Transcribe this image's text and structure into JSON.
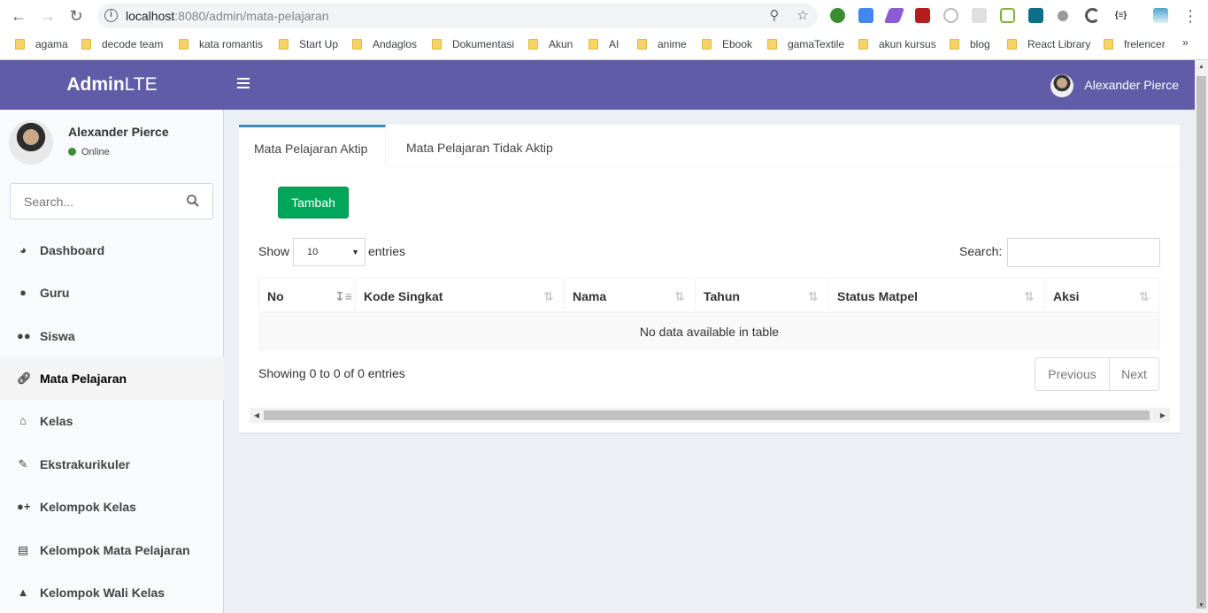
{
  "browser": {
    "url_host": "localhost",
    "url_rest": ":8080/admin/mata-pelajaran",
    "bookmarks": [
      "agama",
      "decode team",
      "kata romantis",
      "Start Up",
      "Andaglos",
      "Dokumentasi",
      "Akun",
      "AI",
      "anime",
      "Ebook",
      "gamaTextile",
      "akun kursus",
      "blog",
      "React Library",
      "frelencer"
    ],
    "more": "»"
  },
  "header": {
    "logo_bold": "Admin",
    "logo_light": "LTE",
    "user_name": "Alexander Pierce",
    "theme_color": "#605ca8"
  },
  "sidebar": {
    "user_name": "Alexander Pierce",
    "status": "Online",
    "search_placeholder": "Search...",
    "items": [
      {
        "label": "Dashboard",
        "icon": "dashboard-icon"
      },
      {
        "label": "Guru",
        "icon": "user-icon"
      },
      {
        "label": "Siswa",
        "icon": "users-icon"
      },
      {
        "label": "Mata Pelajaran",
        "icon": "link-icon",
        "active": true
      },
      {
        "label": "Kelas",
        "icon": "home-icon"
      },
      {
        "label": "Ekstrakurikuler",
        "icon": "edit-icon"
      },
      {
        "label": "Kelompok Kelas",
        "icon": "user-plus-icon"
      },
      {
        "label": "Kelompok Mata Pelajaran",
        "icon": "book-icon"
      },
      {
        "label": "Kelompok Wali Kelas",
        "icon": "user-secret-icon"
      }
    ]
  },
  "content": {
    "tabs": [
      "Mata Pelajaran Aktip",
      "Mata Pelajaran Tidak Aktip"
    ],
    "add_button": "Tambah",
    "show_label": "Show",
    "entries_value": "10",
    "entries_label": "entries",
    "search_label": "Search:",
    "columns": [
      "No",
      "Kode Singkat",
      "Nama",
      "Tahun",
      "Status Matpel",
      "Aksi"
    ],
    "empty_message": "No data available in table",
    "info": "Showing 0 to 0 of 0 entries",
    "prev": "Previous",
    "next": "Next"
  }
}
